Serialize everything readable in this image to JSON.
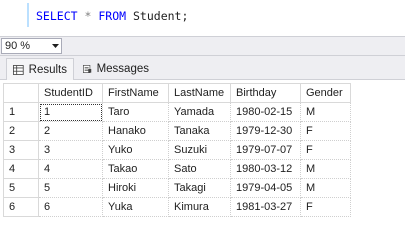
{
  "editor": {
    "keyword_select": "SELECT",
    "star": "*",
    "keyword_from": "FROM",
    "table_name": "Student;"
  },
  "zoom": {
    "value": "90 %"
  },
  "tabs": [
    {
      "label": "Results",
      "icon": "grid-icon"
    },
    {
      "label": "Messages",
      "icon": "messages-icon"
    }
  ],
  "grid": {
    "columns": [
      "StudentID",
      "FirstName",
      "LastName",
      "Birthday",
      "Gender"
    ],
    "rows": [
      {
        "num": "1",
        "cells": [
          "1",
          "Taro",
          "Yamada",
          "1980-02-15",
          "M"
        ]
      },
      {
        "num": "2",
        "cells": [
          "2",
          "Hanako",
          "Tanaka",
          "1979-12-30",
          "F"
        ]
      },
      {
        "num": "3",
        "cells": [
          "3",
          "Yuko",
          "Suzuki",
          "1979-07-07",
          "F"
        ]
      },
      {
        "num": "4",
        "cells": [
          "4",
          "Takao",
          "Sato",
          "1980-03-12",
          "M"
        ]
      },
      {
        "num": "5",
        "cells": [
          "5",
          "Hiroki",
          "Takagi",
          "1979-04-05",
          "M"
        ]
      },
      {
        "num": "6",
        "cells": [
          "6",
          "Yuka",
          "Kimura",
          "1981-03-27",
          "F"
        ]
      }
    ]
  },
  "colors": {
    "keyword": "#0000ff",
    "operator": "#808080"
  }
}
